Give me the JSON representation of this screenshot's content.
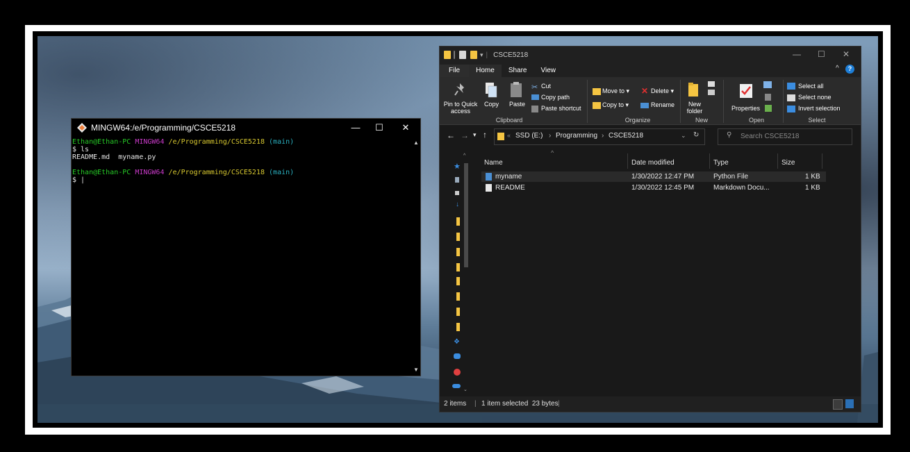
{
  "terminal": {
    "title": "MINGW64:/e/Programming/CSCE5218",
    "lines": [
      {
        "user": "Ethan@Ethan-PC",
        "env": "MINGW64",
        "path": "/e/Programming/CSCE5218",
        "branch": "(main)"
      },
      {
        "text": "$ ls"
      },
      {
        "text": "README.md  myname.py"
      },
      {
        "text": ""
      },
      {
        "user": "Ethan@Ethan-PC",
        "env": "MINGW64",
        "path": "/e/Programming/CSCE5218",
        "branch": "(main)"
      },
      {
        "text": "$ |"
      }
    ],
    "controls": {
      "minimize": "—",
      "maximize": "☐",
      "close": "✕"
    }
  },
  "explorer": {
    "title": "CSCE5218",
    "menu": [
      "File",
      "Home",
      "Share",
      "View"
    ],
    "ribbon": {
      "clipboard": {
        "pin": "Pin to Quick access",
        "copy": "Copy",
        "paste": "Paste",
        "cut": "Cut",
        "copy_path": "Copy path",
        "paste_shortcut": "Paste shortcut",
        "label": "Clipboard"
      },
      "organize": {
        "move_to": "Move to ▾",
        "copy_to": "Copy to ▾",
        "delete": "Delete ▾",
        "rename": "Rename",
        "label": "Organize"
      },
      "new": {
        "new_folder": "New folder",
        "label": "New"
      },
      "open": {
        "properties": "Properties",
        "label": "Open"
      },
      "select": {
        "select_all": "Select all",
        "select_none": "Select none",
        "invert": "Invert selection",
        "label": "Select"
      }
    },
    "address": {
      "crumbs": [
        "SSD (E:)",
        "Programming",
        "CSCE5218"
      ],
      "search_placeholder": "Search CSCE5218"
    },
    "columns": [
      "Name",
      "Date modified",
      "Type",
      "Size"
    ],
    "files": [
      {
        "name": "myname",
        "date": "1/30/2022 12:47 PM",
        "type": "Python File",
        "size": "1 KB",
        "selected": true
      },
      {
        "name": "README",
        "date": "1/30/2022 12:45 PM",
        "type": "Markdown Docu...",
        "size": "1 KB",
        "selected": false
      }
    ],
    "status": {
      "count": "2 items",
      "selection": "1 item selected  23 bytes"
    }
  },
  "colors": {
    "accent": "#0078d7",
    "folder": "#f5c542",
    "terminal_green": "#26c826",
    "terminal_magenta": "#c83ac8",
    "terminal_yellow": "#d8c830",
    "terminal_cyan": "#2ab0c0"
  }
}
